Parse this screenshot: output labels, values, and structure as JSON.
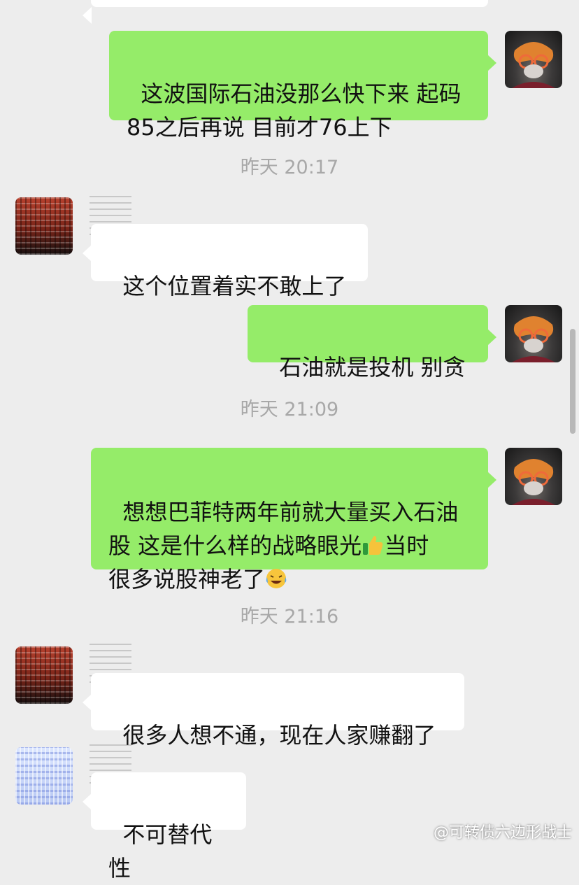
{
  "messages": {
    "m1": "这波国际石油没那么快下来 起码\n85之后再说 目前才76上下",
    "ts1": "昨天 20:17",
    "m2": "这个位置着实不敢上了",
    "m3": "石油就是投机 别贪",
    "ts2": "昨天 21:09",
    "m4a": "想想巴菲特两年前就大量买入石油\n股 这是什么样的战略眼光",
    "m4b": "当时\n很多说股神老了",
    "ts3": "昨天 21:16",
    "m5": "很多人想不通，现在人家赚翻了",
    "m6": "不可替代性"
  },
  "emoji": {
    "thumbs_up": "thumbs-up-icon",
    "laughing_crying": "laughing-crying-icon"
  },
  "watermark": "@可转债六边形战士",
  "colors": {
    "background": "#ededed",
    "outgoing_bubble": "#95ec69",
    "incoming_bubble": "#ffffff",
    "timestamp_text": "#a8a8a8"
  }
}
